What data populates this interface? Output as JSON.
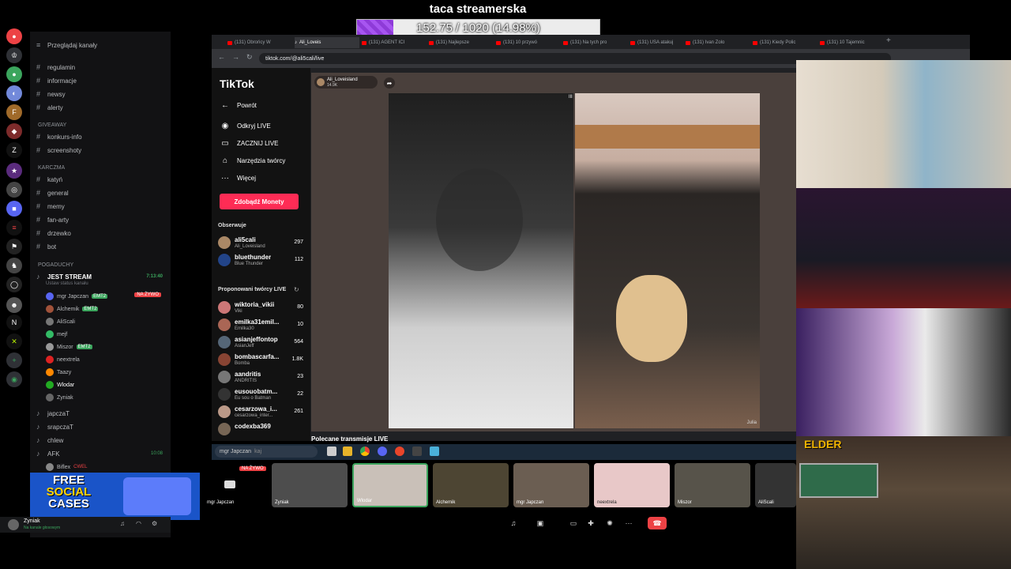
{
  "stream": {
    "title": "taca streamerska",
    "goal_text": "152.75 / 1020 (14.98%)",
    "goal_progress": 0.1498
  },
  "discord": {
    "browse_label": "Przeglądaj kanały",
    "channels_top": [
      "regulamin",
      "informacje",
      "newsy",
      "alerty"
    ],
    "category_giveaway": "GIVEAWAY",
    "channels_giveaway": [
      "konkurs-info",
      "screenshoty"
    ],
    "category_karczma": "KARCZMA",
    "channels_karczma": [
      "katyń",
      "general",
      "memy",
      "fan-arty",
      "drzewko",
      "bot"
    ],
    "category_pogaduchy": "POGADUCHY",
    "voice_main": {
      "name": "JEST STREAM",
      "time": "7:13:40",
      "status": "Ustaw status kanału"
    },
    "voice_users": [
      {
        "name": "mgr Japczan",
        "tag": "EMT2",
        "live": "NA ŻYWO"
      },
      {
        "name": "Alchemik",
        "tag": "EMT2",
        "live": ""
      },
      {
        "name": "AliScali",
        "tag": "",
        "live": ""
      },
      {
        "name": "mejf",
        "tag": "",
        "live": ""
      },
      {
        "name": "Miszor",
        "tag": "EMT2",
        "live": ""
      },
      {
        "name": "neextrela",
        "tag": "",
        "live": ""
      },
      {
        "name": "Taazy",
        "tag": "",
        "live": ""
      },
      {
        "name": "Wlodar",
        "tag": "",
        "live": ""
      },
      {
        "name": "Zyniak",
        "tag": "",
        "live": ""
      }
    ],
    "voice_channels": [
      "japczaT",
      "srapczaT",
      "chlew"
    ],
    "afk": {
      "name": "AFK",
      "time": "10:08"
    },
    "afk_user": "Biflex",
    "afk_user_tag": "CWEL",
    "user": {
      "name": "Zyniak",
      "status": "Na kanale głosowym"
    },
    "promo": {
      "line1": "FREE",
      "line2": "SOCIAL",
      "line3": "CASES"
    }
  },
  "browser": {
    "tabs": [
      "(131) Obrońcy W",
      "Ali_Loveis",
      "(131) AGENT ICI",
      "(131) Najlepsze",
      "(131) 10 przywó",
      "(131) Na tych pro",
      "(131) USA atakuj",
      "(131) Ivan Zolo",
      "(131) Kiedy Polic",
      "(131) 10 Tajemnic"
    ],
    "url": "tiktok.com/@ali5cali/live"
  },
  "tiktok": {
    "logo": "TikTok",
    "menu": [
      {
        "icon": "←",
        "label": "Powrót"
      },
      {
        "icon": "◉",
        "label": "Odkryj LIVE"
      },
      {
        "icon": "▭",
        "label": "ZACZNIJ LIVE"
      },
      {
        "icon": "⌂",
        "label": "Narzędzia twórcy"
      },
      {
        "icon": "···",
        "label": "Więcej"
      }
    ],
    "coins_label": "Zdobądź Monety",
    "following_label": "Obserwuje",
    "following": [
      {
        "name": "ali5cali",
        "sub": "Ali_Loveisland",
        "count": "297"
      },
      {
        "name": "bluethunder",
        "sub": "Blue Thunder",
        "count": "112"
      }
    ],
    "suggested_label": "Proponowani twórcy LIVE",
    "suggested": [
      {
        "name": "wiktoria_vikii",
        "sub": "Viki",
        "count": "80"
      },
      {
        "name": "emilka31emil...",
        "sub": "Emilka30",
        "count": "10"
      },
      {
        "name": "asianjeffontop",
        "sub": "AsianJeff",
        "count": "564"
      },
      {
        "name": "bombascarfa...",
        "sub": "Bomba",
        "count": "1.8K"
      },
      {
        "name": "aandritis",
        "sub": "ANDRITIS",
        "count": "23"
      },
      {
        "name": "eusouobatm...",
        "sub": "Eu sou o Batman",
        "count": "22"
      },
      {
        "name": "cesarzowa_i...",
        "sub": "cesarzowa_inter...",
        "count": "261"
      },
      {
        "name": "codexba369",
        "sub": "",
        "count": ""
      }
    ],
    "live_host": "Ali_Loveisland",
    "live_viewers": "14.9K",
    "recommended_label": "Polecane transmisje LIVE",
    "guest_name": "Julia"
  },
  "taskbar": {
    "search_text": "mgr Japczan",
    "search_suffix": "kaj"
  },
  "call": {
    "live_badge": "NA ŻYWO",
    "tiles": [
      "mgr Japczan",
      "Zyniak",
      "Wlodar",
      "Alchemik",
      "mgr Japczan",
      "neextrela",
      "Miszor",
      "AliScali"
    ]
  },
  "webcam": {
    "elder_label": "ELDER"
  }
}
